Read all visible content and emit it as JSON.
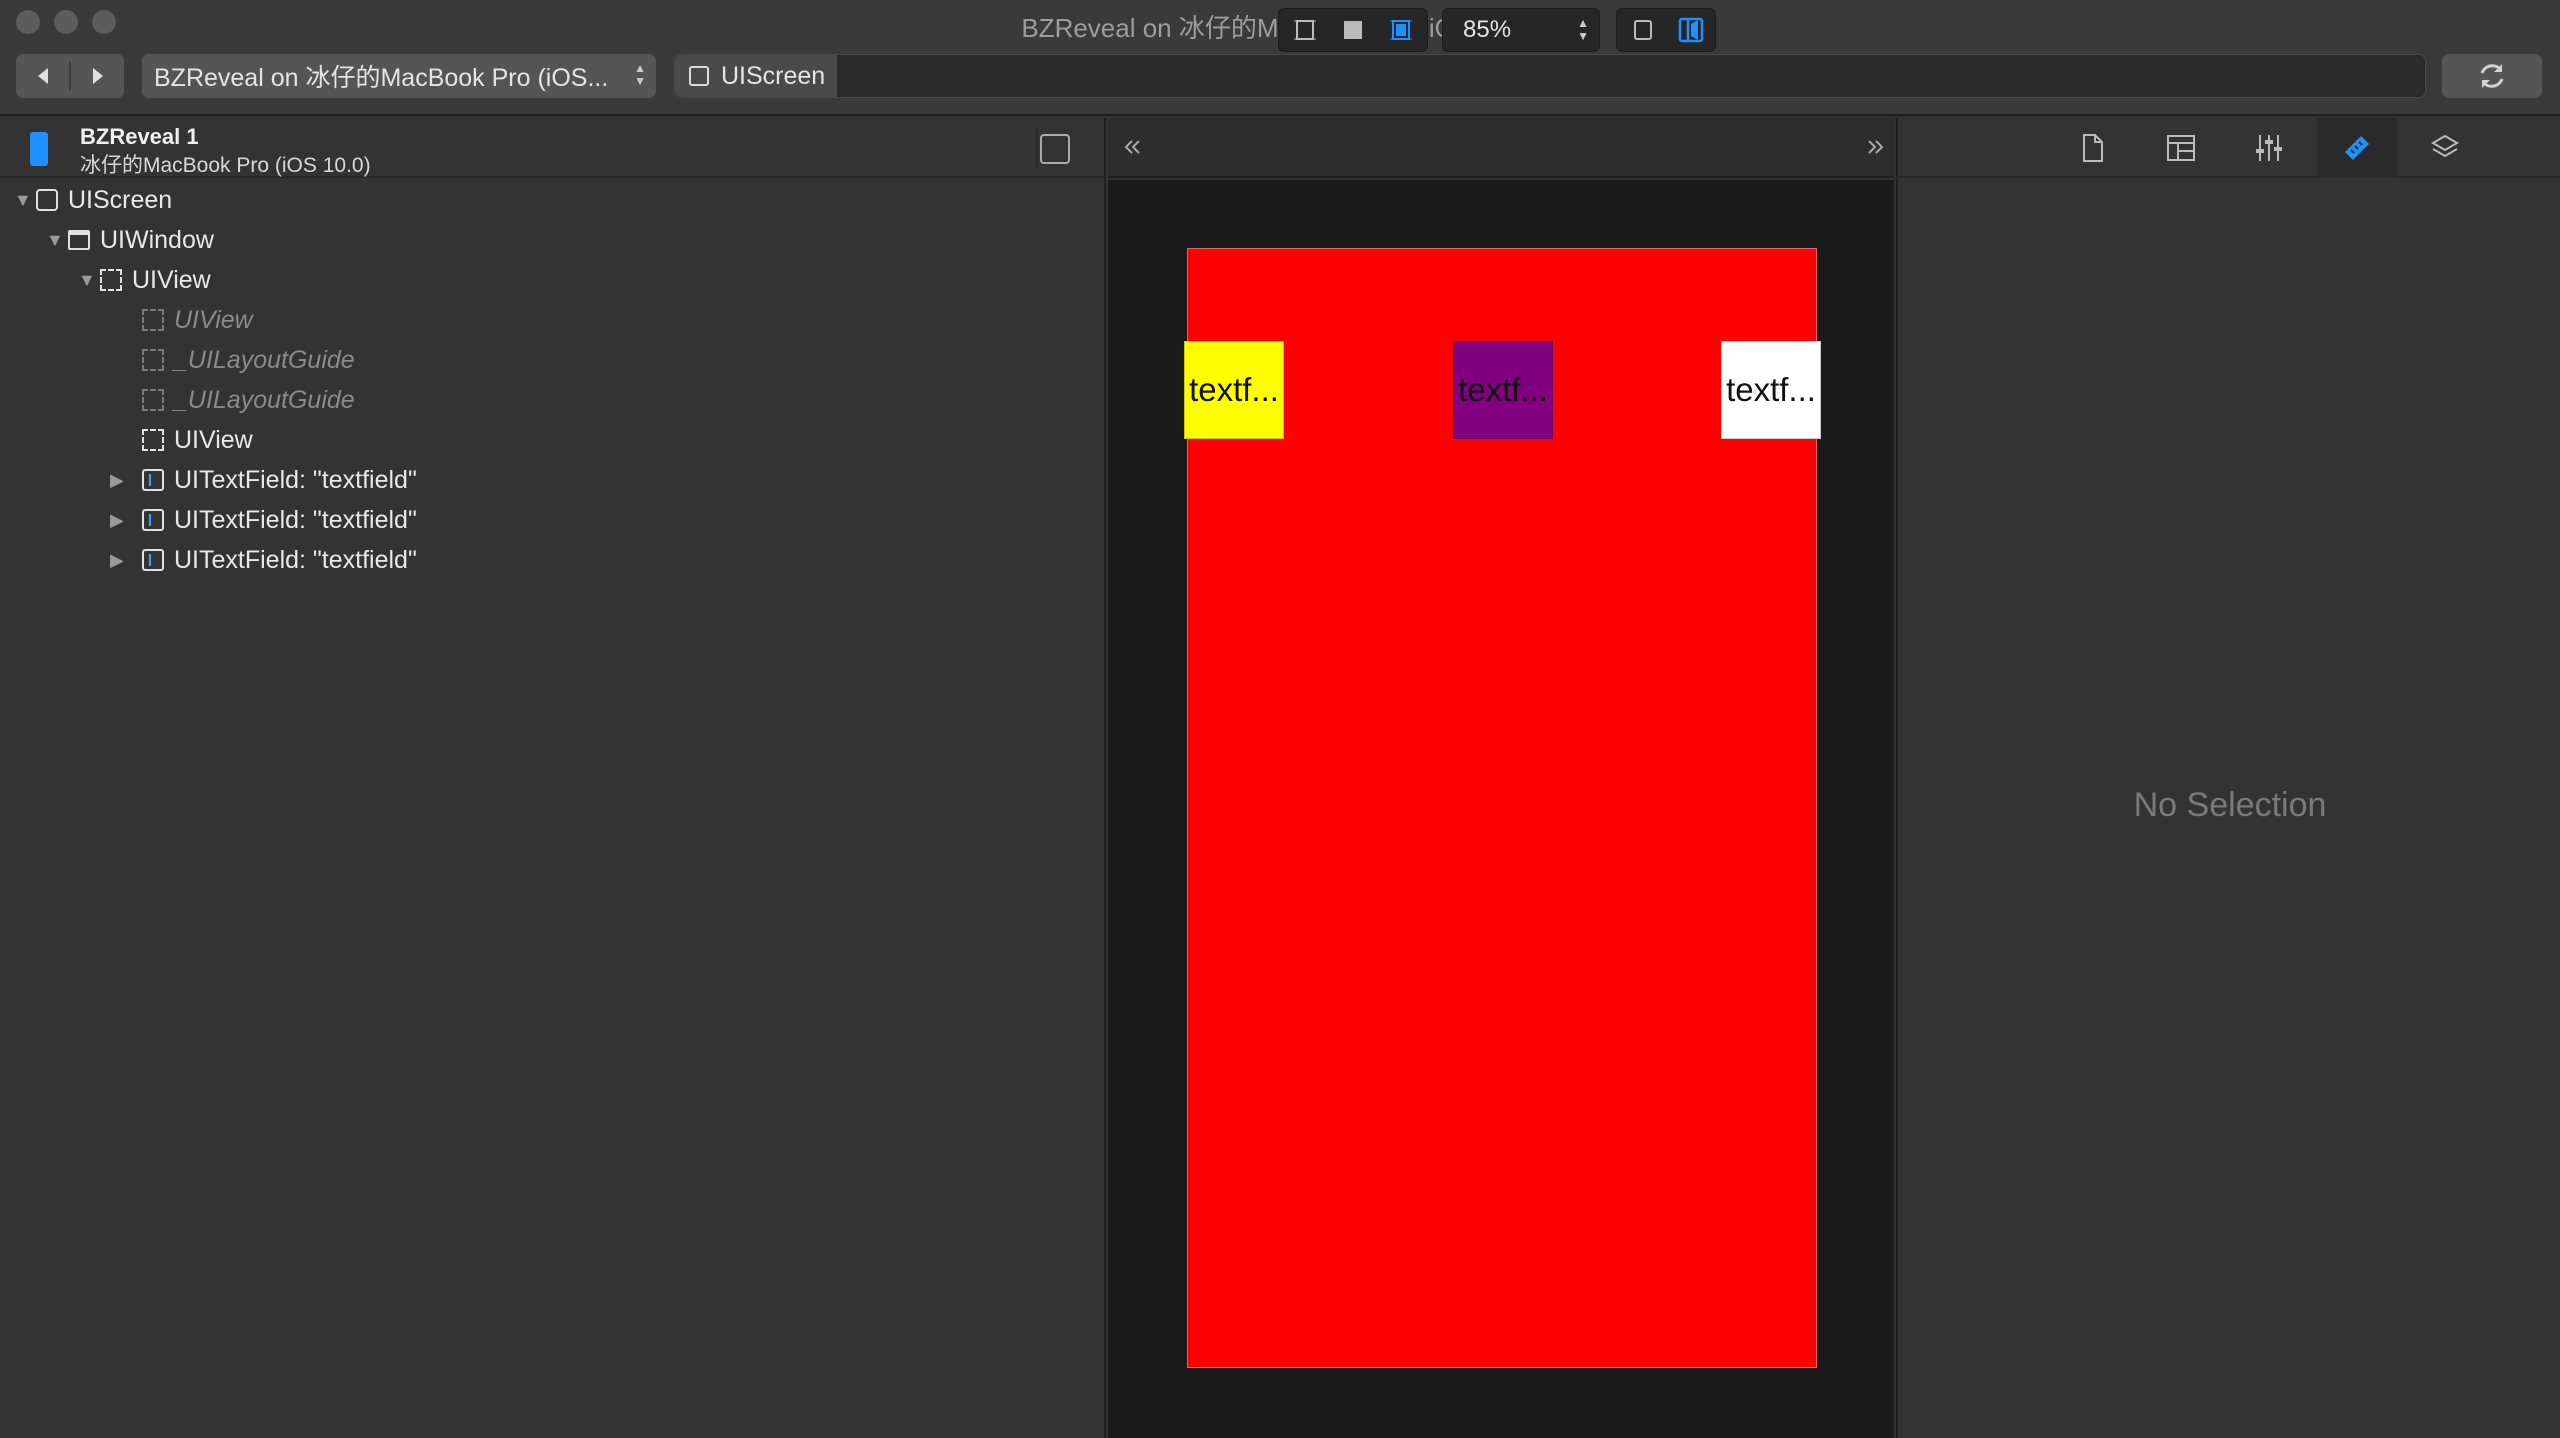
{
  "window": {
    "title": "BZReveal on 冰仔的MacBook Pro (iOS 10.0)"
  },
  "toolbar": {
    "device_select": "BZReveal on 冰仔的MacBook Pro (iOS...",
    "path": [
      "UIScreen"
    ]
  },
  "app": {
    "name": "BZReveal 1",
    "device": "冰仔的MacBook Pro (iOS 10.0)"
  },
  "tree": [
    {
      "label": "UIScreen",
      "icon": "screen-icon",
      "expanded": true,
      "dim": false
    },
    {
      "label": "UIWindow",
      "icon": "window-icon",
      "expanded": true,
      "dim": false
    },
    {
      "label": "UIView",
      "icon": "view-icon",
      "expanded": true,
      "dim": false
    },
    {
      "label": "UIView",
      "icon": "view-icon",
      "dim": true
    },
    {
      "label": "_UILayoutGuide",
      "icon": "view-icon",
      "dim": true
    },
    {
      "label": "_UILayoutGuide",
      "icon": "view-icon",
      "dim": true
    },
    {
      "label": "UIView",
      "icon": "view-icon",
      "dim": false
    },
    {
      "label": "UITextField: \"textfield\"",
      "icon": "textfield-icon",
      "expanded": false,
      "dim": false
    },
    {
      "label": "UITextField: \"textfield\"",
      "icon": "textfield-icon",
      "expanded": false,
      "dim": false
    },
    {
      "label": "UITextField: \"textfield\"",
      "icon": "textfield-icon",
      "expanded": false,
      "dim": false
    }
  ],
  "canvas": {
    "zoom": "85%",
    "preview_background": "#ff0000",
    "textfields": [
      {
        "text": "textf...",
        "color": "#ffff00"
      },
      {
        "text": "textf...",
        "color": "#800080"
      },
      {
        "text": "textf...",
        "color": "#ffffff"
      }
    ]
  },
  "inspector": {
    "tabs": [
      "file-icon",
      "layout-icon",
      "sliders-icon",
      "ruler-icon",
      "layers-icon"
    ],
    "active_tab": "ruler-icon",
    "empty_text": "No Selection"
  },
  "colors": {
    "accent": "#1e90ff"
  }
}
